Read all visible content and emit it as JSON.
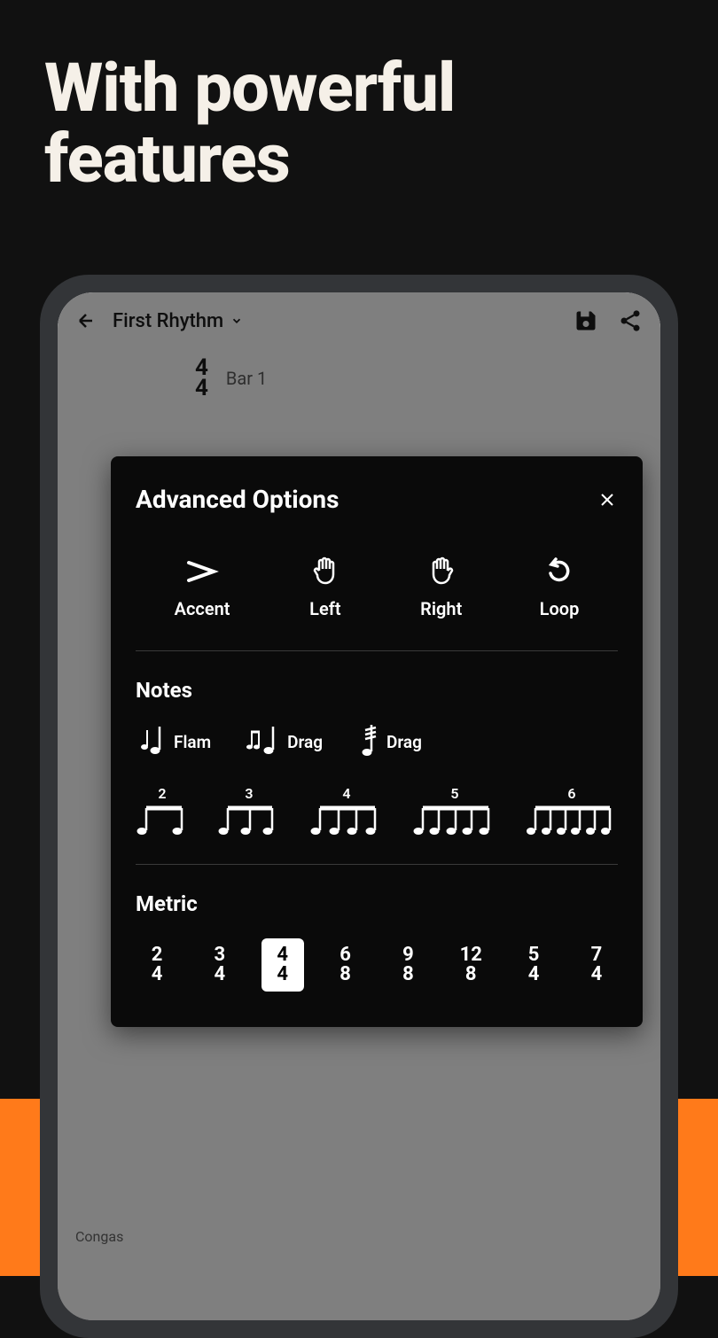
{
  "headline": "With powerful features",
  "header": {
    "title": "First Rhythm"
  },
  "timeSig": {
    "top": "4",
    "bot": "4",
    "barLabel": "Bar 1"
  },
  "modal": {
    "title": "Advanced Options",
    "options": [
      {
        "label": "Accent"
      },
      {
        "label": "Left"
      },
      {
        "label": "Right"
      },
      {
        "label": "Loop"
      }
    ],
    "notesTitle": "Notes",
    "noteOrnaments": [
      {
        "label": "Flam"
      },
      {
        "label": "Drag"
      },
      {
        "label": "Drag"
      }
    ],
    "tuplets": [
      "2",
      "3",
      "4",
      "5",
      "6"
    ],
    "metricTitle": "Metric",
    "metrics": [
      {
        "top": "2",
        "bot": "4",
        "selected": false
      },
      {
        "top": "3",
        "bot": "4",
        "selected": false
      },
      {
        "top": "4",
        "bot": "4",
        "selected": true
      },
      {
        "top": "6",
        "bot": "8",
        "selected": false
      },
      {
        "top": "9",
        "bot": "8",
        "selected": false
      },
      {
        "top": "12",
        "bot": "8",
        "selected": false
      },
      {
        "top": "5",
        "bot": "4",
        "selected": false
      },
      {
        "top": "7",
        "bot": "4",
        "selected": false
      }
    ]
  },
  "instrument": "Congas"
}
